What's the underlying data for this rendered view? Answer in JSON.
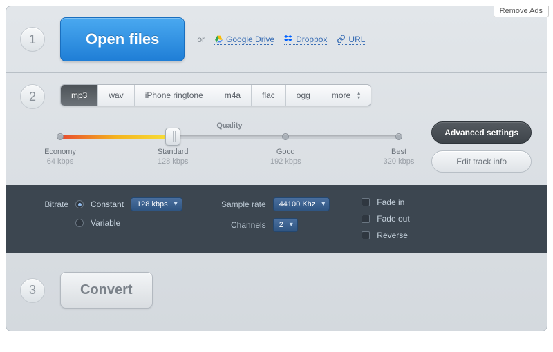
{
  "remove_ads": "Remove Ads",
  "steps": {
    "s1": "1",
    "s2": "2",
    "s3": "3"
  },
  "open_files": "Open files",
  "or": "or",
  "sources": {
    "gdrive": "Google Drive",
    "dropbox": "Dropbox",
    "url": "URL"
  },
  "formats": [
    "mp3",
    "wav",
    "iPhone ringtone",
    "m4a",
    "flac",
    "ogg",
    "more"
  ],
  "quality": {
    "label": "Quality",
    "stops": [
      {
        "name": "Economy",
        "rate": "64 kbps"
      },
      {
        "name": "Standard",
        "rate": "128 kbps"
      },
      {
        "name": "Good",
        "rate": "192 kbps"
      },
      {
        "name": "Best",
        "rate": "320 kbps"
      }
    ]
  },
  "advanced_settings": "Advanced settings",
  "edit_track_info": "Edit track info",
  "advanced": {
    "bitrate_label": "Bitrate",
    "constant": "Constant",
    "variable": "Variable",
    "bitrate_value": "128 kbps",
    "sample_rate_label": "Sample rate",
    "sample_rate_value": "44100 Khz",
    "channels_label": "Channels",
    "channels_value": "2",
    "fade_in": "Fade in",
    "fade_out": "Fade out",
    "reverse": "Reverse"
  },
  "convert": "Convert"
}
